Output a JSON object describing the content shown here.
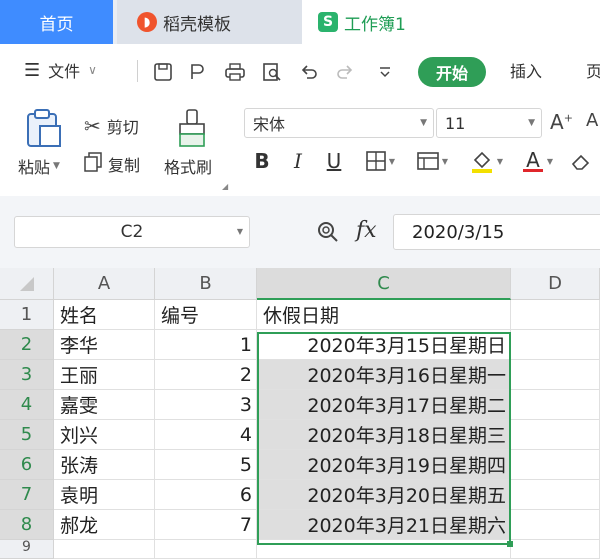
{
  "tabs": {
    "home": "首页",
    "daoke": "稻壳模板",
    "workbook": "工作簿1"
  },
  "menu": {
    "file": "文件",
    "start": "开始",
    "insert": "插入",
    "page_partial": "页"
  },
  "ribbon": {
    "paste": "粘贴",
    "cut": "剪切",
    "copy": "复制",
    "format_painter": "格式刷",
    "font_name": "宋体",
    "font_size": "11",
    "bold": "B",
    "italic": "I",
    "underline": "U",
    "font_color_letter": "A"
  },
  "formula_bar": {
    "cell_ref": "C2",
    "fx": "fx",
    "value": "2020/3/15"
  },
  "sheet": {
    "columns": [
      "A",
      "B",
      "C",
      "D"
    ],
    "row_numbers": [
      "1",
      "2",
      "3",
      "4",
      "5",
      "6",
      "7",
      "8",
      "9"
    ],
    "header": {
      "a": "姓名",
      "b": "编号",
      "c": "休假日期"
    },
    "rows": [
      {
        "name": "李华",
        "num": "1",
        "date": "2020年3月15日星期日"
      },
      {
        "name": "王丽",
        "num": "2",
        "date": "2020年3月16日星期一"
      },
      {
        "name": "嘉雯",
        "num": "3",
        "date": "2020年3月17日星期二"
      },
      {
        "name": "刘兴",
        "num": "4",
        "date": "2020年3月18日星期三"
      },
      {
        "name": "张涛",
        "num": "5",
        "date": "2020年3月19日星期四"
      },
      {
        "name": "袁明",
        "num": "6",
        "date": "2020年3月20日星期五"
      },
      {
        "name": "郝龙",
        "num": "7",
        "date": "2020年3月21日星期六"
      }
    ]
  },
  "colors": {
    "accent_blue": "#3f8cff",
    "accent_green": "#2f9e57",
    "selection_gray": "#dedede"
  }
}
